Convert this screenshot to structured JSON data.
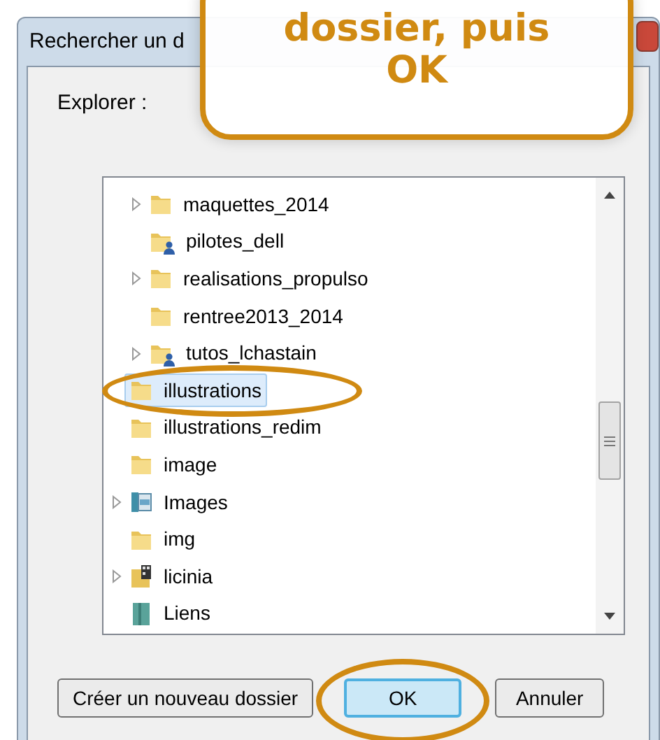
{
  "window": {
    "title": "Rechercher un d"
  },
  "callout": {
    "lines": [
      "dossier, puis",
      "OK"
    ]
  },
  "prompt": "Explorer :",
  "tree": [
    {
      "children": [
        {
          "label": "maquettes_2014",
          "kind": "folder",
          "expandable": true,
          "selected": false
        },
        {
          "label": "pilotes_dell",
          "kind": "user-folder",
          "expandable": false,
          "selected": false
        },
        {
          "label": "realisations_propulso",
          "kind": "folder",
          "expandable": true,
          "selected": false
        },
        {
          "label": "rentree2013_2014",
          "kind": "folder",
          "expandable": false,
          "selected": false
        },
        {
          "label": "tutos_lchastain",
          "kind": "user-folder",
          "expandable": true,
          "selected": false
        }
      ]
    },
    {
      "label": "illustrations",
      "kind": "folder",
      "expandable": false,
      "selected": true,
      "circled": true
    },
    {
      "label": "illustrations_redim",
      "kind": "folder",
      "expandable": false,
      "selected": false
    },
    {
      "label": "image",
      "kind": "folder",
      "expandable": false,
      "selected": false
    },
    {
      "label": "Images",
      "kind": "library",
      "expandable": true,
      "selected": false
    },
    {
      "label": "img",
      "kind": "folder",
      "expandable": false,
      "selected": false
    },
    {
      "label": "licinia",
      "kind": "media-folder",
      "expandable": true,
      "selected": false
    },
    {
      "label": "Liens",
      "kind": "links",
      "expandable": false,
      "selected": false
    }
  ],
  "buttons": [
    {
      "label": "Créer un nouveau dossier",
      "default": false,
      "circled": false
    },
    {
      "label": "OK",
      "default": true,
      "circled": true
    },
    {
      "label": "Annuler",
      "default": false,
      "circled": false
    }
  ]
}
